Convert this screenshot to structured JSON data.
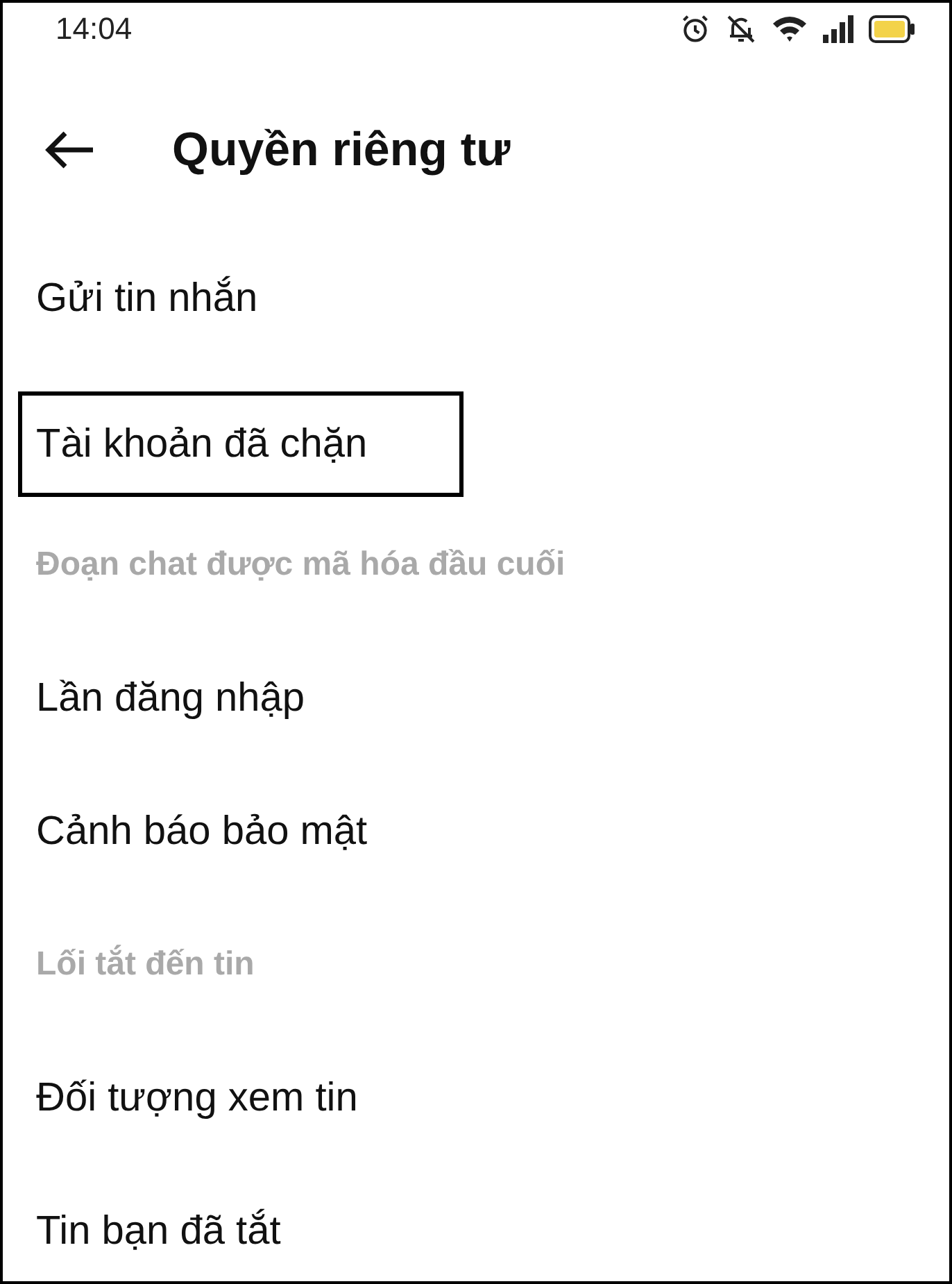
{
  "status_bar": {
    "time": "14:04"
  },
  "header": {
    "title": "Quyền riêng tư"
  },
  "items": [
    {
      "kind": "item",
      "label": "Gửi tin nhắn",
      "highlighted": false
    },
    {
      "kind": "item",
      "label": "Tài khoản đã chặn",
      "highlighted": true
    },
    {
      "kind": "section",
      "label": "Đoạn chat được mã hóa đầu cuối"
    },
    {
      "kind": "item",
      "label": "Lần đăng nhập",
      "highlighted": false
    },
    {
      "kind": "item",
      "label": "Cảnh báo bảo mật",
      "highlighted": false
    },
    {
      "kind": "section",
      "label": "Lối tắt đến tin"
    },
    {
      "kind": "item",
      "label": "Đối tượng xem tin",
      "highlighted": false
    },
    {
      "kind": "item",
      "label": "Tin bạn đã tắt",
      "highlighted": false
    }
  ]
}
